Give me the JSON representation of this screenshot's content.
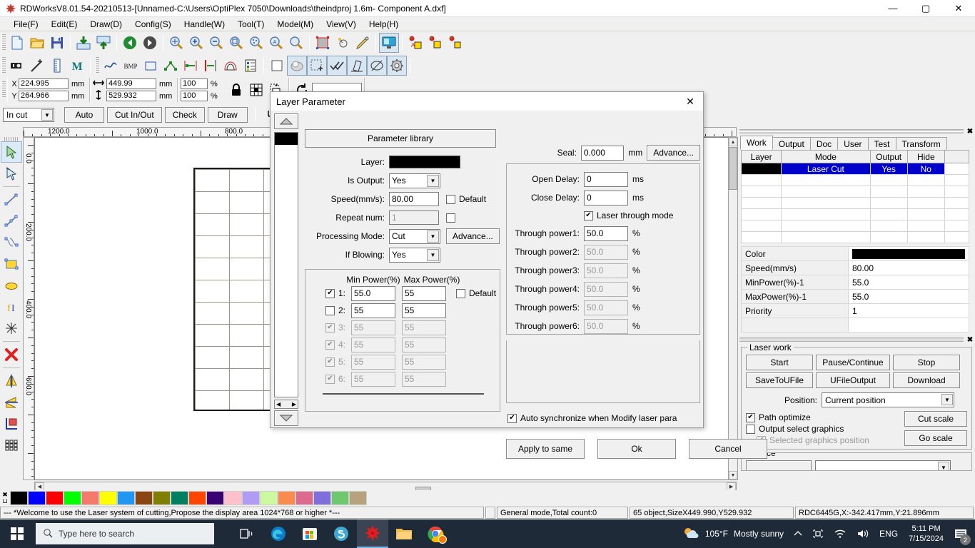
{
  "window": {
    "title": "RDWorksV8.01.54-20210513-[Unnamed-C:\\Users\\OptiPlex 7050\\Downloads\\theindproj 1.6m- Component A.dxf]",
    "minimize": "—",
    "maximize": "▢",
    "close": "✕"
  },
  "menu": {
    "items": [
      "File(F)",
      "Edit(E)",
      "Draw(D)",
      "Config(S)",
      "Handle(W)",
      "Tool(T)",
      "Model(M)",
      "View(V)",
      "Help(H)"
    ]
  },
  "coordbar": {
    "x_label": "X",
    "y_label": "Y",
    "x_value": "224.995",
    "y_value": "264.966",
    "x_unit": "mm",
    "y_unit": "mm",
    "width_value": "449.99",
    "height_value": "529.932",
    "width_unit": "mm",
    "height_unit": "mm",
    "scale_x": "100",
    "scale_y": "100",
    "scale_unit_x": "%",
    "scale_unit_y": "%"
  },
  "cutbar": {
    "mode_selected": "In cut",
    "auto": "Auto",
    "cut_in_out": "Cut In/Out",
    "check": "Check",
    "draw": "Draw"
  },
  "rulers": {
    "horizontal_labels": [
      "1200.0",
      "1000.0",
      "800.0"
    ],
    "vertical_labels": [
      "0.0",
      "200.0",
      "400.0",
      "600.0"
    ]
  },
  "palette": {
    "colors": [
      "#000000",
      "#0000ff",
      "#ff0000",
      "#00ff00",
      "#f4796b",
      "#ffff00",
      "#2196f3",
      "#8b4513",
      "#808000",
      "#008060",
      "#ff4500",
      "#3b0071",
      "#ffc0cb",
      "#b09cf5",
      "#ccf9a0",
      "#f98b4e",
      "#dd6a8e",
      "#7f6fdd",
      "#6ec86e",
      "#b7a27e"
    ]
  },
  "statusbar": {
    "message": "--- *Welcome to use the Laser system of cutting,Propose the display area 1024*768 or higher *---",
    "mode": "General mode,Total count:0",
    "objects": "65 object,SizeX449.990,Y529.932",
    "device": "RDC6445G,X:-342.417mm,Y:21.896mm"
  },
  "right_panel": {
    "tabs": [
      "Work",
      "Output",
      "Doc",
      "User",
      "Test",
      "Transform"
    ],
    "active_tab": "Work",
    "layer_table": {
      "headers": [
        "Layer",
        "Mode",
        "Output",
        "Hide",
        ""
      ],
      "rows": [
        {
          "layer_color": "#000000",
          "mode": "Laser Cut",
          "output": "Yes",
          "hide": "No",
          "extra": "",
          "selected": true
        }
      ]
    },
    "properties": [
      {
        "key": "Color",
        "value": "",
        "is_color": true,
        "color": "#000000"
      },
      {
        "key": "Speed(mm/s)",
        "value": "80.00"
      },
      {
        "key": "MinPower(%)-1",
        "value": "55.0"
      },
      {
        "key": "MaxPower(%)-1",
        "value": "55.0"
      },
      {
        "key": "Priority",
        "value": "1"
      }
    ],
    "laser_work": {
      "title": "Laser work",
      "buttons": [
        "Start",
        "Pause/Continue",
        "Stop",
        "SaveToUFile",
        "UFileOutput",
        "Download"
      ],
      "position_label": "Position:",
      "position_value": "Current position",
      "path_optimize": {
        "label": "Path optimize",
        "checked": true
      },
      "output_select_graphics": {
        "label": "Output select graphics",
        "checked": false
      },
      "selected_graphics_position": {
        "label": "Selected graphics position",
        "checked": true,
        "disabled": true
      },
      "cut_scale": "Cut scale",
      "go_scale": "Go scale"
    },
    "device": {
      "title": "Device"
    }
  },
  "dialog": {
    "title": "Layer Parameter",
    "close": "✕",
    "parameter_library": "Parameter library",
    "fields": {
      "layer_label": "Layer:",
      "layer_color": "#000000",
      "is_output_label": "Is Output:",
      "is_output_value": "Yes",
      "speed_label": "Speed(mm/s):",
      "speed_value": "80.00",
      "speed_default_label": "Default",
      "speed_default_checked": false,
      "repeat_label": "Repeat num:",
      "repeat_value": "1",
      "repeat_checked": false,
      "processing_mode_label": "Processing Mode:",
      "processing_mode_value": "Cut",
      "processing_advance": "Advance...",
      "if_blowing_label": "If Blowing:",
      "if_blowing_value": "Yes"
    },
    "power": {
      "min_header": "Min Power(%)",
      "max_header": "Max Power(%)",
      "default_label": "Default",
      "default_checked": false,
      "rows": [
        {
          "index": "1:",
          "min": "55.0",
          "max": "55",
          "checked": true,
          "disabled": false
        },
        {
          "index": "2:",
          "min": "55",
          "max": "55",
          "checked": false,
          "disabled": false
        },
        {
          "index": "3:",
          "min": "55",
          "max": "55",
          "checked": true,
          "disabled": true
        },
        {
          "index": "4:",
          "min": "55",
          "max": "55",
          "checked": true,
          "disabled": true
        },
        {
          "index": "5:",
          "min": "55",
          "max": "55",
          "checked": true,
          "disabled": true
        },
        {
          "index": "6:",
          "min": "55",
          "max": "55",
          "checked": true,
          "disabled": true
        }
      ]
    },
    "right": {
      "seal_label": "Seal:",
      "seal_value": "0.000",
      "seal_unit": "mm",
      "seal_advance": "Advance...",
      "open_delay_label": "Open Delay:",
      "open_delay_value": "0",
      "open_delay_unit": "ms",
      "close_delay_label": "Close Delay:",
      "close_delay_value": "0",
      "close_delay_unit": "ms",
      "laser_through_label": "Laser through mode",
      "laser_through_checked": true,
      "through_rows": [
        {
          "label": "Through power1:",
          "value": "50.0",
          "unit": "%",
          "disabled": false
        },
        {
          "label": "Through power2:",
          "value": "50.0",
          "unit": "%",
          "disabled": true
        },
        {
          "label": "Through power3:",
          "value": "50.0",
          "unit": "%",
          "disabled": true
        },
        {
          "label": "Through power4:",
          "value": "50.0",
          "unit": "%",
          "disabled": true
        },
        {
          "label": "Through power5:",
          "value": "50.0",
          "unit": "%",
          "disabled": true
        },
        {
          "label": "Through power6:",
          "value": "50.0",
          "unit": "%",
          "disabled": true
        }
      ],
      "auto_sync_label": "Auto synchronize when Modify laser para",
      "auto_sync_checked": true,
      "apply_to_same": "Apply to same",
      "ok": "Ok",
      "cancel": "Cancel"
    }
  },
  "taskbar": {
    "search_placeholder": "Type here to search",
    "weather_temp": "105°F",
    "weather_desc": "Mostly sunny",
    "language": "ENG",
    "time": "5:11 PM",
    "date": "7/15/2024",
    "notification_count": "2"
  }
}
